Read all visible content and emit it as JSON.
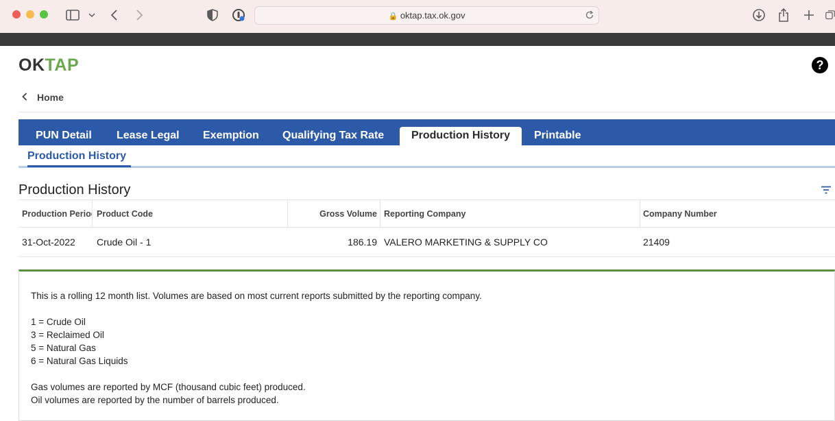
{
  "browser": {
    "url": "oktap.tax.ok.gov"
  },
  "app": {
    "logo_ok": "OK",
    "logo_tap": "TAP",
    "help_label": "?",
    "home_label": "Home"
  },
  "tabs": [
    {
      "label": "PUN Detail"
    },
    {
      "label": "Lease Legal"
    },
    {
      "label": "Exemption"
    },
    {
      "label": "Qualifying Tax Rate"
    },
    {
      "label": "Production History"
    },
    {
      "label": "Printable"
    }
  ],
  "active_tab": "Production History",
  "subtab": "Production History",
  "section_title": "Production History",
  "table": {
    "columns": [
      "Production Period",
      "Product Code",
      "Gross Volume",
      "Reporting Company",
      "Company Number"
    ],
    "rows": [
      {
        "period": "31-Oct-2022",
        "product": "Crude Oil - 1",
        "volume": "186.19",
        "company": "VALERO MARKETING & SUPPLY CO",
        "number": "21409"
      }
    ]
  },
  "info": {
    "intro": "This is a rolling 12 month list. Volumes are based on most current reports submitted by the reporting company.",
    "codes": [
      "1 = Crude Oil",
      "3 = Reclaimed Oil",
      "5 = Natural Gas",
      "6 = Natural Gas Liquids"
    ],
    "gas_note": "Gas volumes are reported by MCF (thousand cubic feet) produced.",
    "oil_note": "Oil volumes are reported by the number of barrels produced."
  },
  "colors": {
    "tab_bar": "#2c5aa8",
    "logo_accent": "#6aa84f",
    "info_border": "#5a8f3e"
  }
}
